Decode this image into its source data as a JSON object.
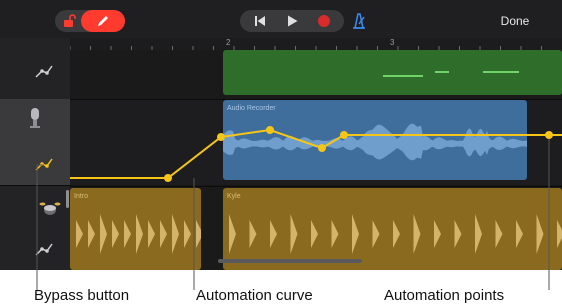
{
  "toolbar": {
    "done_label": "Done",
    "accent_color": "#ff3b30",
    "icons": [
      "lock-open-icon",
      "pencil-icon",
      "skip-back-icon",
      "play-icon",
      "record-icon",
      "metronome-icon"
    ]
  },
  "ruler": {
    "bars": [
      "2",
      "3"
    ]
  },
  "tracks": [
    {
      "icon": "automation-node-icon",
      "selected": false
    },
    {
      "icon": "microphone-icon",
      "automation_icon": "automation-node-icon",
      "selected": true
    },
    {
      "icon": "drum-kit-icon",
      "automation_icon": "automation-node-icon",
      "selected": false
    }
  ],
  "regions": {
    "audio_recorder": "Audio Recorder",
    "intro": "Intro",
    "kyle": "Kyle"
  },
  "colors": {
    "automation": "#f5c518",
    "audio_region": "#3f6e9c",
    "drum_region": "#8a6a1f",
    "green_region": "#2f6d2b"
  },
  "callouts": {
    "bypass": "Bypass button",
    "curve": "Automation curve",
    "points": "Automation points"
  }
}
